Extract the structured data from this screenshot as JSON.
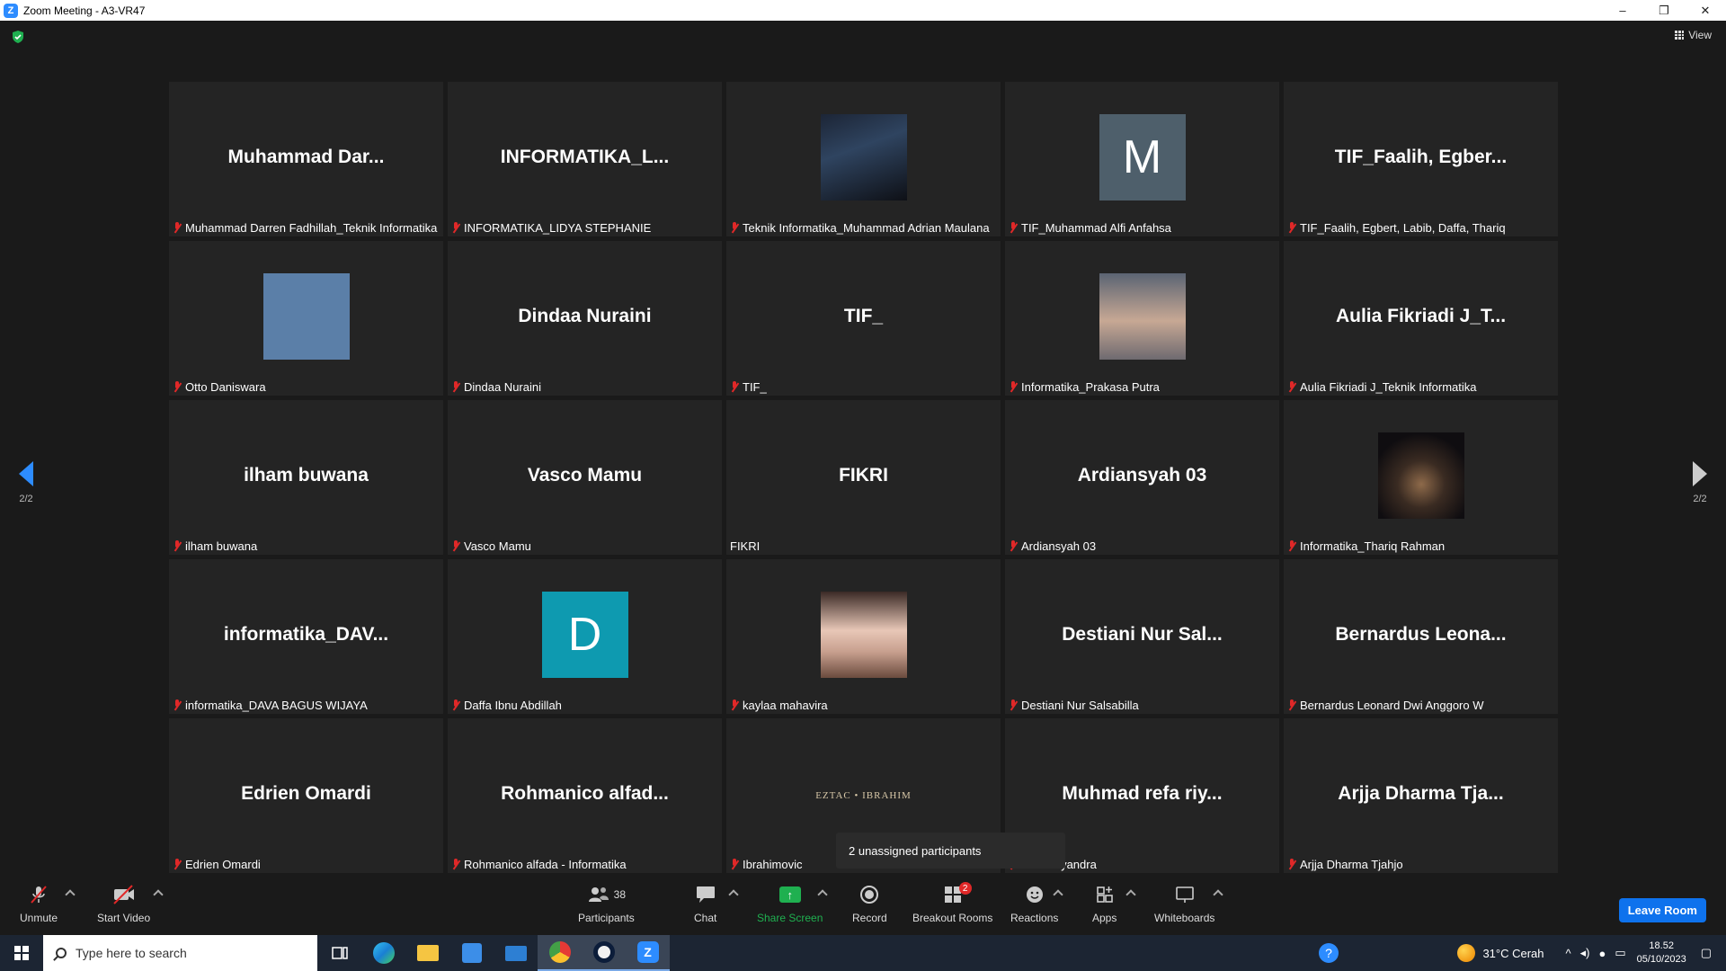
{
  "window": {
    "title": "Zoom Meeting - A3-VR47",
    "logo_letter": "Z",
    "minimize": "–",
    "restore": "❐",
    "close": "✕"
  },
  "meeting": {
    "view_label": "View",
    "page_left": "2/2",
    "page_right": "2/2",
    "unassigned_tooltip": "2 unassigned participants"
  },
  "tiles": [
    {
      "big": "Muhammad  Dar...",
      "label": "Muhammad Darren Fadhillah_Teknik Informatika",
      "muted": true
    },
    {
      "big": "INFORMATIKA_L...",
      "label": "INFORMATIKA_LIDYA STEPHANIE",
      "muted": true
    },
    {
      "big": "",
      "label": "Teknik Informatika_Muhammad Adrian Maulana",
      "muted": true,
      "avatar": "av-photo-dark"
    },
    {
      "big": "",
      "label": "TIF_Muhammad Alfi Anfahsa",
      "muted": true,
      "avatar": "av-letter-M",
      "avatar_text": "M"
    },
    {
      "big": "TIF_Faalih,  Egber...",
      "label": "TIF_Faalih, Egbert, Labib, Daffa, Thariq",
      "muted": true
    },
    {
      "big": "",
      "label": "Otto Daniswara",
      "muted": true,
      "avatar": "av-blue"
    },
    {
      "big": "Dindaa Nuraini",
      "label": "Dindaa Nuraini",
      "muted": true
    },
    {
      "big": "TIF_",
      "label": "TIF_",
      "muted": true
    },
    {
      "big": "",
      "label": "Informatika_Prakasa Putra",
      "muted": true,
      "avatar": "av-photo-face"
    },
    {
      "big": "Aulia Fikriadi J_T...",
      "label": "Aulia Fikriadi J_Teknik Informatika",
      "muted": true
    },
    {
      "big": "ilham buwana",
      "label": "ilham buwana",
      "muted": true
    },
    {
      "big": "Vasco Mamu",
      "label": "Vasco Mamu",
      "muted": true
    },
    {
      "big": "FIKRI",
      "label": "FIKRI",
      "muted": false
    },
    {
      "big": "Ardiansyah 03",
      "label": "Ardiansyah 03",
      "muted": true
    },
    {
      "big": "",
      "label": "Informatika_Thariq Rahman",
      "muted": true,
      "avatar": "av-photo-night"
    },
    {
      "big": "informatika_DAV...",
      "label": "informatika_DAVA BAGUS WIJAYA",
      "muted": true
    },
    {
      "big": "",
      "label": "Daffa Ibnu Abdillah",
      "muted": true,
      "avatar": "av-letter-D",
      "avatar_text": "D"
    },
    {
      "big": "",
      "label": "kaylaa mahavira",
      "muted": true,
      "avatar": "av-photo-girl"
    },
    {
      "big": "Destiani Nur Sal...",
      "label": "Destiani Nur Salsabilla",
      "muted": true
    },
    {
      "big": "Bernardus  Leona...",
      "label": "Bernardus Leonard Dwi Anggoro W",
      "muted": true
    },
    {
      "big": "Edrien Omardi",
      "label": "Edrien Omardi",
      "muted": true
    },
    {
      "big": "Rohmanico  alfad...",
      "label": "Rohmanico alfada - Informatika",
      "muted": true
    },
    {
      "big": "",
      "label": "Ibrahimovic",
      "muted": true,
      "logo_text": "EZTAC • IBRAHIM"
    },
    {
      "big": "Muhmad  refa riy...",
      "label": "d refa riyandra",
      "muted": true
    },
    {
      "big": "Arjja Dharma  Tja...",
      "label": "Arjja Dharma Tjahjo",
      "muted": true
    }
  ],
  "toolbar": {
    "unmute": "Unmute",
    "start_video": "Start Video",
    "participants": "Participants",
    "participants_count": "38",
    "chat": "Chat",
    "share_screen": "Share Screen",
    "record": "Record",
    "breakout_rooms": "Breakout Rooms",
    "breakout_badge": "2",
    "reactions": "Reactions",
    "apps": "Apps",
    "whiteboards": "Whiteboards",
    "leave_room": "Leave Room"
  },
  "taskbar": {
    "search_placeholder": "Type here to search",
    "weather": "31°C  Cerah",
    "time": "18.52",
    "date": "05/10/2023"
  },
  "colors": {
    "accent": "#2d8cff",
    "muted_mic": "#e02828",
    "share_green": "#1fb050",
    "leave_blue": "#0e72ed"
  }
}
